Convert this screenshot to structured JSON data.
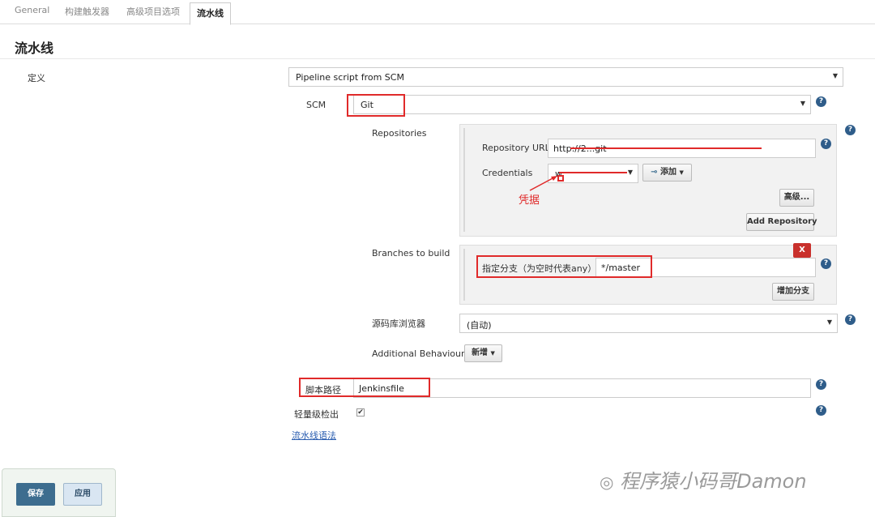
{
  "tabs": [
    "General",
    "构建触发器",
    "高级项目选项",
    "流水线"
  ],
  "section_title": "流水线",
  "definition": {
    "label": "定义",
    "value": "Pipeline script from SCM"
  },
  "scm": {
    "label": "SCM",
    "value": "Git"
  },
  "repositories": {
    "label": "Repositories",
    "url_label": "Repository URL",
    "url_value": "http://2...git",
    "credentials_label": "Credentials",
    "credentials_value": "w",
    "add_label": "添加",
    "annotation": "凭据",
    "advanced_button": "高级...",
    "add_repository_button": "Add Repository"
  },
  "branches": {
    "label": "Branches to build",
    "specifier_label": "指定分支（为空时代表any）",
    "specifier_value": "*/master",
    "delete_button": "X",
    "add_branch_button": "增加分支"
  },
  "browser": {
    "label": "源码库浏览器",
    "value": "(自动)"
  },
  "additional": {
    "label": "Additional Behaviours",
    "button": "新增"
  },
  "script_path": {
    "label": "脚本路径",
    "value": "Jenkinsfile"
  },
  "lightweight": {
    "label": "轻量级检出",
    "checked": true
  },
  "syntax_link": "流水线语法",
  "buttons": {
    "save": "保存",
    "apply": "应用"
  },
  "watermark": "程序猿小码哥Damon",
  "colors": {
    "highlight": "#e02a2a",
    "save_bg": "#3d6d8f",
    "help": "#2f5d8a"
  }
}
